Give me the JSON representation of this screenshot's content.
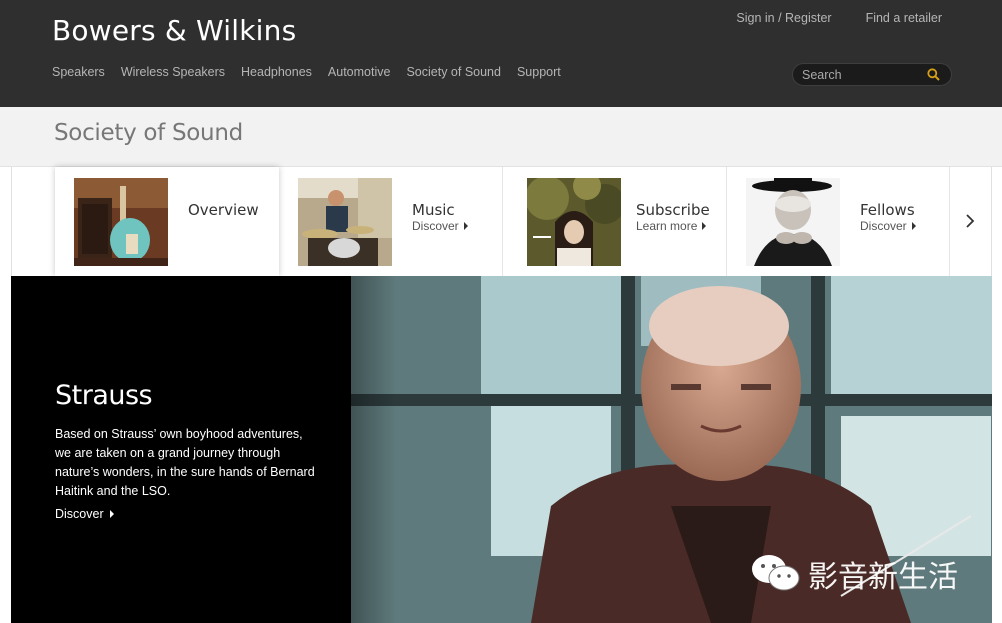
{
  "header": {
    "logo": "Bowers & Wilkins",
    "nav": [
      "Speakers",
      "Wireless Speakers",
      "Headphones",
      "Automotive",
      "Society of Sound",
      "Support"
    ],
    "top_links": [
      "Sign in / Register",
      "Find a retailer"
    ],
    "search_placeholder": "Search"
  },
  "section": {
    "title": "Society of Sound"
  },
  "carousel": {
    "cards": [
      {
        "title": "Overview",
        "subtitle": "",
        "thumb_icon": "guitar-amp-photo"
      },
      {
        "title": "Music",
        "subtitle": "Discover",
        "thumb_icon": "drummer-photo"
      },
      {
        "title": "Subscribe",
        "subtitle": "Learn more",
        "thumb_icon": "album-cover-photo"
      },
      {
        "title": "Fellows",
        "subtitle": "Discover",
        "thumb_icon": "fellow-portrait-photo"
      }
    ],
    "next_icon": "chevron-right-icon"
  },
  "hero": {
    "title": "Strauss",
    "body": "Based on Strauss’ own boyhood adventures, we are taken on a grand journey through nature’s wonders, in the sure hands of Bernard Haitink and the LSO.",
    "link": "Discover"
  },
  "watermark": {
    "text": "影音新生活",
    "icon": "wechat-icon"
  },
  "colors": {
    "header_bg": "#2f2f2f",
    "section_bg": "#f2f2f2",
    "hero_bg": "#000000",
    "search_accent": "#d4a017"
  }
}
